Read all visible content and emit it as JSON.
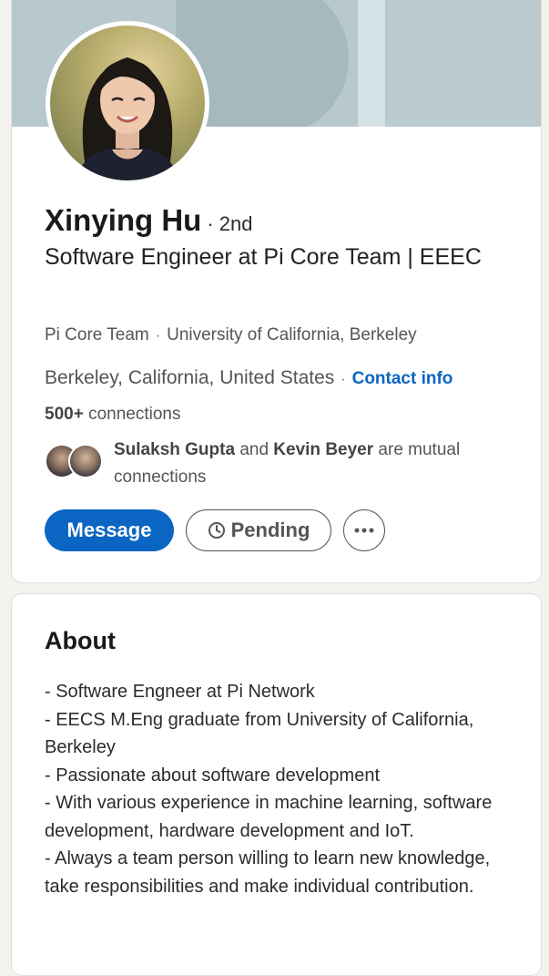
{
  "profile": {
    "name": "Xinying Hu",
    "degree": "· 2nd",
    "headline": "Software Engineer at Pi Core Team | EEEC",
    "company": "Pi Core Team",
    "school": "University of California, Berkeley",
    "separator": "·",
    "location": "Berkeley, California, United States",
    "contact_info": "Contact info",
    "connections_count": "500+",
    "connections_label": "connections",
    "mutual": {
      "first": "Sulaksh Gupta",
      "and": "and",
      "second": "Kevin Beyer",
      "suffix": "are mutual connections"
    },
    "actions": {
      "message": "Message",
      "pending": "Pending",
      "more": "more-icon"
    }
  },
  "about": {
    "title": "About",
    "lines": [
      "- Software Engneer at Pi Network",
      "- EECS M.Eng graduate from University of California, Berkeley",
      "- Passionate about software development",
      "- With various experience in machine learning, software development, hardware development and IoT.",
      "- Always a team person willing to learn new knowledge, take responsibilities and make individual contribution."
    ]
  },
  "colors": {
    "accent": "#0a66c2",
    "banner": "#b8c9ce",
    "page_background": "#f3f2ef"
  }
}
